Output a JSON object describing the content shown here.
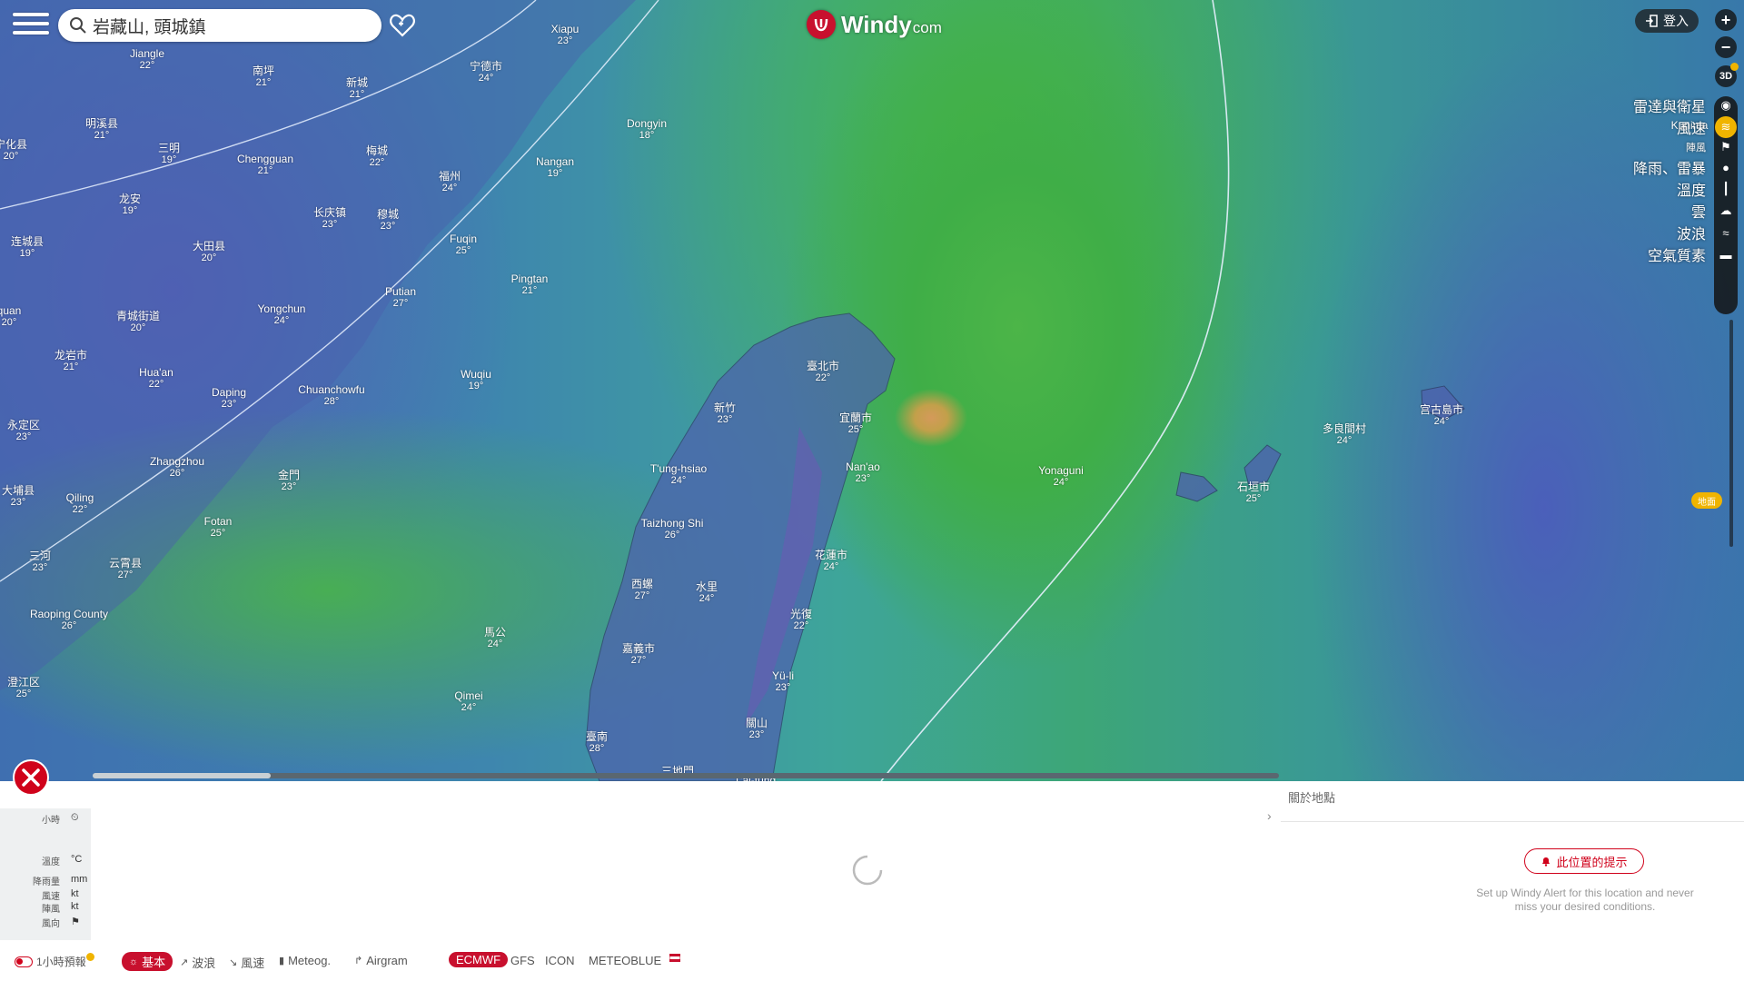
{
  "search": {
    "value": "岩藏山, 頭城鎮",
    "icon": "search-icon"
  },
  "logo": {
    "name": "Windy",
    "domain": "com"
  },
  "login": {
    "label": "登入"
  },
  "controls": {
    "zoom_in": "+",
    "zoom_out": "−",
    "btn_3d": "3D"
  },
  "layers": [
    {
      "label": "雷達與衛星",
      "icon": "radar-icon",
      "small": false,
      "active": false
    },
    {
      "label": "風速",
      "icon": "wind-icon",
      "small": false,
      "active": true
    },
    {
      "label": "陣風",
      "icon": "flag-icon",
      "small": true,
      "active": false
    },
    {
      "label": "降雨、雷暴",
      "icon": "rain-drop-icon",
      "small": false,
      "active": false
    },
    {
      "label": "溫度",
      "icon": "thermometer-icon",
      "small": false,
      "active": false
    },
    {
      "label": "雲",
      "icon": "cloud-icon",
      "small": false,
      "active": false
    },
    {
      "label": "波浪",
      "icon": "waves-icon",
      "small": false,
      "active": false
    },
    {
      "label": "空氣質素",
      "icon": "car-icon",
      "small": false,
      "active": false
    }
  ],
  "overlay_badge": "地面",
  "map_labels": [
    {
      "name": "Jiangle",
      "temp": "22°"
    },
    {
      "name": "南坪",
      "temp": "21°"
    },
    {
      "name": "新城",
      "temp": "21°"
    },
    {
      "name": "Xiapu",
      "temp": "23°"
    },
    {
      "name": "宁德市",
      "temp": "24°"
    },
    {
      "name": "明溪县",
      "temp": "21°"
    },
    {
      "name": "三明",
      "temp": "19°"
    },
    {
      "name": "Chengguan",
      "temp": "21°"
    },
    {
      "name": "梅城",
      "temp": "22°"
    },
    {
      "name": "福州",
      "temp": "24°"
    },
    {
      "name": "Dongyin",
      "temp": "18°"
    },
    {
      "name": "Nangan",
      "temp": "19°"
    },
    {
      "name": "龙安",
      "temp": "19°"
    },
    {
      "name": "长庆镇",
      "temp": "23°"
    },
    {
      "name": "穆城",
      "temp": "23°"
    },
    {
      "name": "Fuqin",
      "temp": "25°"
    },
    {
      "name": "连城县",
      "temp": "19°"
    },
    {
      "name": "大田县",
      "temp": "20°"
    },
    {
      "name": "Putian",
      "temp": "27°"
    },
    {
      "name": "Pingtan",
      "temp": "21°"
    },
    {
      "name": "青城街道",
      "temp": "20°"
    },
    {
      "name": "Yongchun",
      "temp": "24°"
    },
    {
      "name": "龙岩市",
      "temp": "21°"
    },
    {
      "name": "Hua'an",
      "temp": "22°"
    },
    {
      "name": "Daping",
      "temp": "23°"
    },
    {
      "name": "Chuanchowfu",
      "temp": "28°"
    },
    {
      "name": "Wuqiu",
      "temp": "19°"
    },
    {
      "name": "臺北市",
      "temp": "22°"
    },
    {
      "name": "新竹",
      "temp": "23°"
    },
    {
      "name": "宜蘭市",
      "temp": "25°"
    },
    {
      "name": "永定区",
      "temp": "23°"
    },
    {
      "name": "Zhangzhou",
      "temp": "26°"
    },
    {
      "name": "金門",
      "temp": "23°"
    },
    {
      "name": "Nan'ao",
      "temp": "23°"
    },
    {
      "name": "Yonaguni",
      "temp": "24°"
    },
    {
      "name": "宫古島市",
      "temp": "24°"
    },
    {
      "name": "多良間村",
      "temp": "24°"
    },
    {
      "name": "石垣市",
      "temp": "25°"
    },
    {
      "name": "大埔县",
      "temp": "23°"
    },
    {
      "name": "Qiling",
      "temp": "22°"
    },
    {
      "name": "Fotan",
      "temp": "25°"
    },
    {
      "name": "Taizhong Shi",
      "temp": "26°"
    },
    {
      "name": "花蓮市",
      "temp": "24°"
    },
    {
      "name": "三河",
      "temp": "23°"
    },
    {
      "name": "云霄县",
      "temp": "27°"
    },
    {
      "name": "西螺",
      "temp": "27°"
    },
    {
      "name": "水里",
      "temp": "24°"
    },
    {
      "name": "光復",
      "temp": "22°"
    },
    {
      "name": "Raoping County",
      "temp": "26°"
    },
    {
      "name": "馬公",
      "temp": "24°"
    },
    {
      "name": "嘉義市",
      "temp": "27°"
    },
    {
      "name": "Yü-li",
      "temp": "23°"
    },
    {
      "name": "澄江区",
      "temp": "25°"
    },
    {
      "name": "Qimei",
      "temp": "24°"
    },
    {
      "name": "關山",
      "temp": "23°"
    },
    {
      "name": "臺南",
      "temp": "28°"
    },
    {
      "name": "三地門",
      "temp": ""
    },
    {
      "name": "T'ai-tung",
      "temp": ""
    },
    {
      "name": "T'ung-hsiao",
      "temp": "24°"
    },
    {
      "name": "宁化县",
      "temp": "20°"
    },
    {
      "name": "quan",
      "temp": "20°"
    },
    {
      "name": "Kunima",
      "temp": ""
    }
  ],
  "timeline": {
    "progress": 0.15
  },
  "panel": {
    "about_point": "關於地點",
    "alert_button": "此位置的提示",
    "alert_desc": "Set up Windy Alert for this location and never miss your desired conditions."
  },
  "legend": [
    {
      "key": "小時",
      "unit": "⏲"
    },
    {
      "key": "溫度",
      "unit": "°C"
    },
    {
      "key": "降雨量",
      "unit": "mm"
    },
    {
      "key": "風速",
      "unit": "kt"
    },
    {
      "key": "陣風",
      "unit": "kt"
    },
    {
      "key": "風向",
      "unit": "⚑"
    }
  ],
  "bottom_bar": {
    "toggle_1h": "1小時預報",
    "tabs": [
      "基本",
      "波浪",
      "風速",
      "Meteog.",
      "Airgram"
    ],
    "models": [
      "ECMWF",
      "GFS",
      "ICON",
      "METEOBLUE"
    ]
  },
  "colors": {
    "accent": "#c8102e",
    "highlight": "#f0b400"
  }
}
